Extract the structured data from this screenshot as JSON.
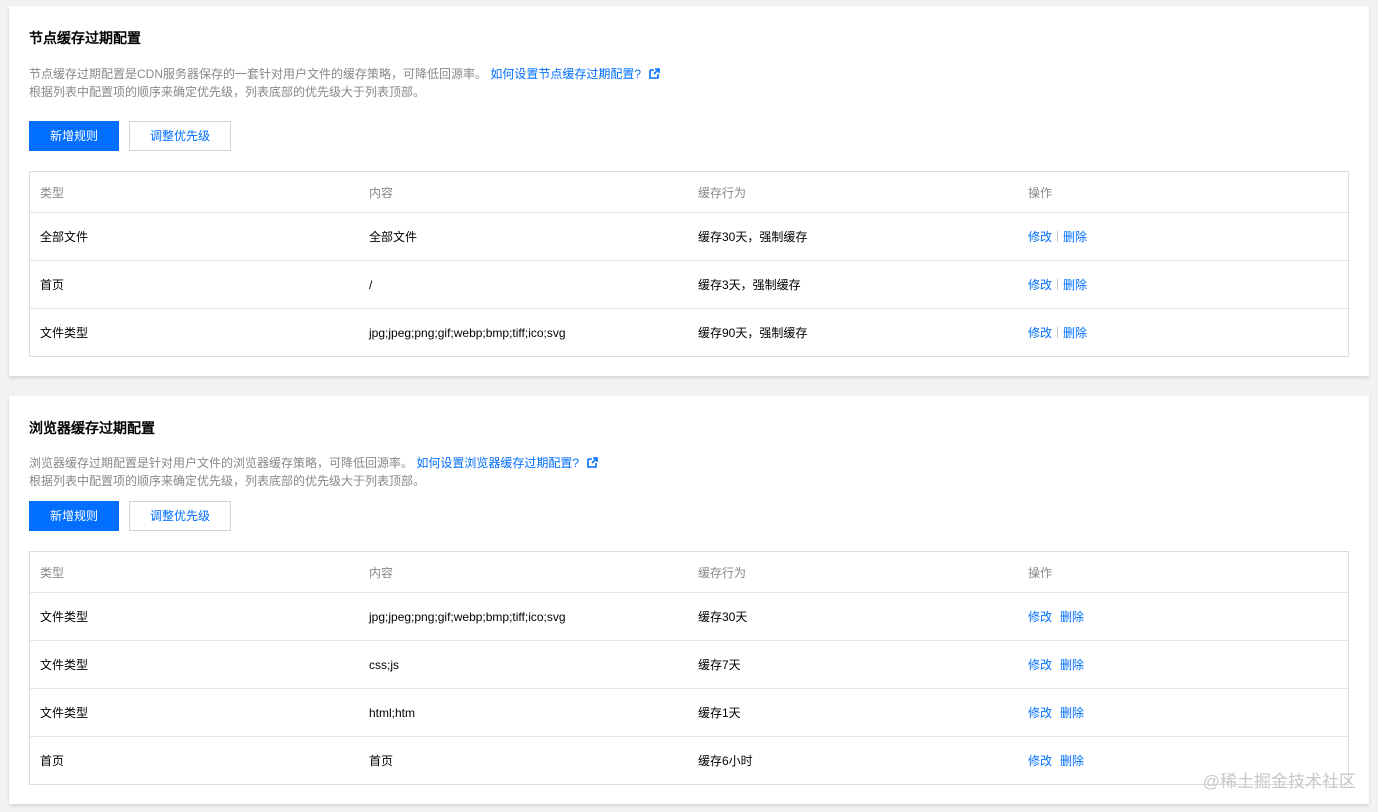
{
  "node_cache": {
    "title": "节点缓存过期配置",
    "desc_line1": "节点缓存过期配置是CDN服务器保存的一套针对用户文件的缓存策略，可降低回源率。",
    "help_link": "如何设置节点缓存过期配置?",
    "desc_line2": "根据列表中配置项的顺序来确定优先级，列表底部的优先级大于列表顶部。",
    "add_button": "新增规则",
    "priority_button": "调整优先级",
    "columns": [
      "类型",
      "内容",
      "缓存行为",
      "操作"
    ],
    "rows": [
      {
        "type": "全部文件",
        "content": "全部文件",
        "behavior": "缓存30天，强制缓存",
        "edit": "修改",
        "delete": "删除"
      },
      {
        "type": "首页",
        "content": "/",
        "behavior": "缓存3天，强制缓存",
        "edit": "修改",
        "delete": "删除"
      },
      {
        "type": "文件类型",
        "content": "jpg;jpeg;png;gif;webp;bmp;tiff;ico;svg",
        "behavior": "缓存90天，强制缓存",
        "edit": "修改",
        "delete": "删除"
      }
    ]
  },
  "browser_cache": {
    "title": "浏览器缓存过期配置",
    "desc_line1": "浏览器缓存过期配置是针对用户文件的浏览器缓存策略，可降低回源率。",
    "help_link": "如何设置浏览器缓存过期配置?",
    "desc_line2": "根据列表中配置项的顺序来确定优先级，列表底部的优先级大于列表顶部。",
    "add_button": "新增规则",
    "priority_button": "调整优先级",
    "columns": [
      "类型",
      "内容",
      "缓存行为",
      "操作"
    ],
    "rows": [
      {
        "type": "文件类型",
        "content": "jpg;jpeg;png;gif;webp;bmp;tiff;ico;svg",
        "behavior": "缓存30天",
        "edit": "修改",
        "delete": "删除"
      },
      {
        "type": "文件类型",
        "content": "css;js",
        "behavior": "缓存7天",
        "edit": "修改",
        "delete": "删除"
      },
      {
        "type": "文件类型",
        "content": "html;htm",
        "behavior": "缓存1天",
        "edit": "修改",
        "delete": "删除"
      },
      {
        "type": "首页",
        "content": "首页",
        "behavior": "缓存6小时",
        "edit": "修改",
        "delete": "删除"
      }
    ]
  },
  "watermark": "@稀土掘金技术社区",
  "colors": {
    "accent": "#006eff",
    "muted_text": "#888888",
    "border": "#dcdcdc"
  },
  "icons": {
    "external_link": "external-link-icon"
  }
}
